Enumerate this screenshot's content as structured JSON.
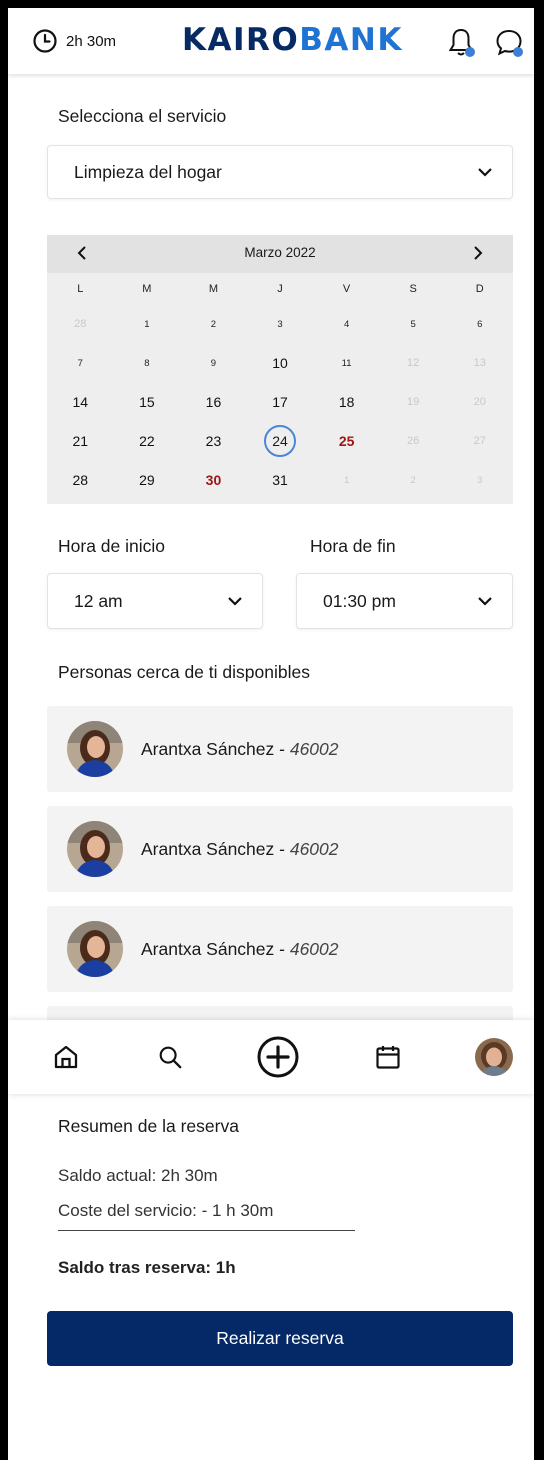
{
  "header": {
    "balance": "2h 30m",
    "brand_main": "KAIRO",
    "brand_accent": "BANK"
  },
  "service": {
    "label": "Selecciona el servicio",
    "selected": "Limpieza del hogar"
  },
  "calendar": {
    "month_label": "Marzo 2022",
    "weekdays": [
      "L",
      "M",
      "M",
      "J",
      "V",
      "S",
      "D"
    ],
    "weeks": [
      [
        "28",
        "1",
        "2",
        "3",
        "4",
        "5",
        "6"
      ],
      [
        "7",
        "8",
        "9",
        "10",
        "11",
        "12",
        "13"
      ],
      [
        "14",
        "15",
        "16",
        "17",
        "18",
        "19",
        "20"
      ],
      [
        "21",
        "22",
        "23",
        "24",
        "25",
        "26",
        "27"
      ],
      [
        "28",
        "29",
        "30",
        "31",
        "1",
        "2",
        "3"
      ]
    ],
    "selected_day": "24"
  },
  "time": {
    "start_label": "Hora de inicio",
    "start_value": "12 am",
    "end_label": "Hora de fin",
    "end_value": "01:30 pm"
  },
  "people": {
    "title": "Personas cerca de ti disponibles",
    "items": [
      {
        "name": "Arantxa Sánchez",
        "zip": "46002"
      },
      {
        "name": "Arantxa Sánchez",
        "zip": "46002"
      },
      {
        "name": "Arantxa Sánchez",
        "zip": "46002"
      }
    ]
  },
  "summary": {
    "title": "Resumen de la reserva",
    "current": "Saldo actual: 2h 30m",
    "cost": "Coste del servicio: - 1 h 30m",
    "after": "Saldo tras reserva: 1h",
    "cta": "Realizar reserva"
  },
  "nav": [
    "home-icon",
    "search-icon",
    "add-circle-icon",
    "calendar-icon",
    "profile-avatar"
  ],
  "colors": {
    "brand_dark": "#062a63",
    "brand_accent": "#1e73d3",
    "button": "#052966",
    "weekend_red": "#a01414",
    "selected_ring": "#4a86d6"
  }
}
